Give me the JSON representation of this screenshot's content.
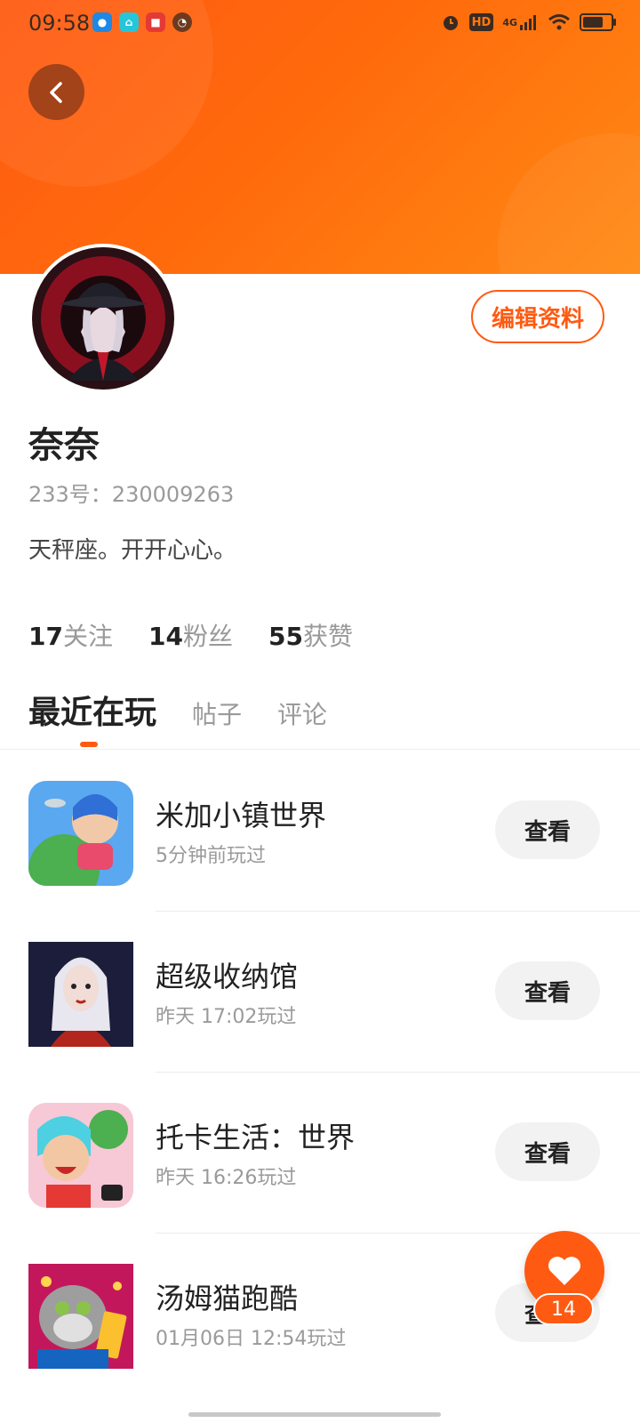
{
  "status_bar": {
    "time": "09:58",
    "network": "4G",
    "hd": "HD",
    "icons": [
      "alarm-icon",
      "hd-icon",
      "signal-icon",
      "wifi-icon",
      "battery-icon"
    ]
  },
  "profile": {
    "name": "奈奈",
    "uid": "233号：230009263",
    "bio": "天秤座。开开心心。",
    "edit_label": "编辑资料"
  },
  "stats": [
    {
      "num": "17",
      "label": "关注"
    },
    {
      "num": "14",
      "label": "粉丝"
    },
    {
      "num": "55",
      "label": "获赞"
    }
  ],
  "tabs": [
    {
      "label": "最近在玩",
      "active": true
    },
    {
      "label": "帖子",
      "active": false
    },
    {
      "label": "评论",
      "active": false
    }
  ],
  "games": [
    {
      "title": "米加小镇世界",
      "time": "5分钟前玩过",
      "button": "查看"
    },
    {
      "title": "超级收纳馆",
      "time": "昨天 17:02玩过",
      "button": "查看"
    },
    {
      "title": "托卡生活：世界",
      "time": "昨天 16:26玩过",
      "button": "查看"
    },
    {
      "title": "汤姆猫跑酷",
      "time": "01月06日 12:54玩过",
      "button": "查看"
    }
  ],
  "like_fab": {
    "count": "14"
  },
  "colors": {
    "accent": "#ff5a12",
    "banner": "#ff6a0c"
  }
}
